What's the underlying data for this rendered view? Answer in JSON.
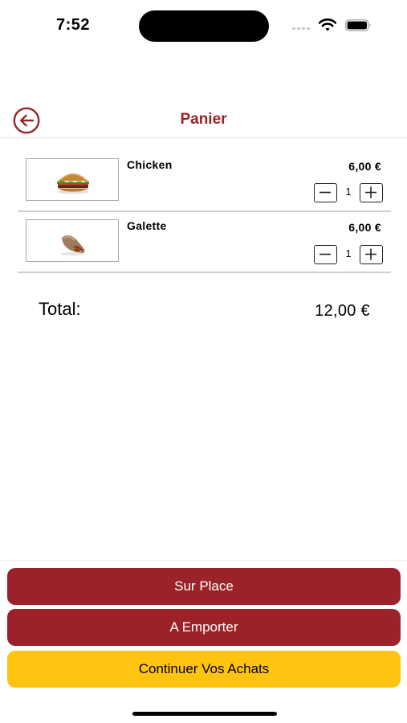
{
  "status_bar": {
    "time": "7:52",
    "icons": [
      "cellular-signal-icon",
      "wifi-icon",
      "battery-icon"
    ]
  },
  "nav": {
    "title": "Panier",
    "back_icon": "arrow-left-circle-icon"
  },
  "cart": {
    "items": [
      {
        "name": "Chicken",
        "price": "6,00 €",
        "quantity": "1",
        "image_icon": "burger-image"
      },
      {
        "name": "Galette",
        "price": "6,00 €",
        "quantity": "1",
        "image_icon": "wrap-image"
      }
    ],
    "total_label": "Total:",
    "total_value": "12,00 €"
  },
  "actions": {
    "dine_in": "Sur Place",
    "take_away": "A Emporter",
    "continue_shopping": "Continuer Vos Achats"
  },
  "colors": {
    "brand_red": "#9b2228",
    "accent_yellow": "#fec40f"
  }
}
